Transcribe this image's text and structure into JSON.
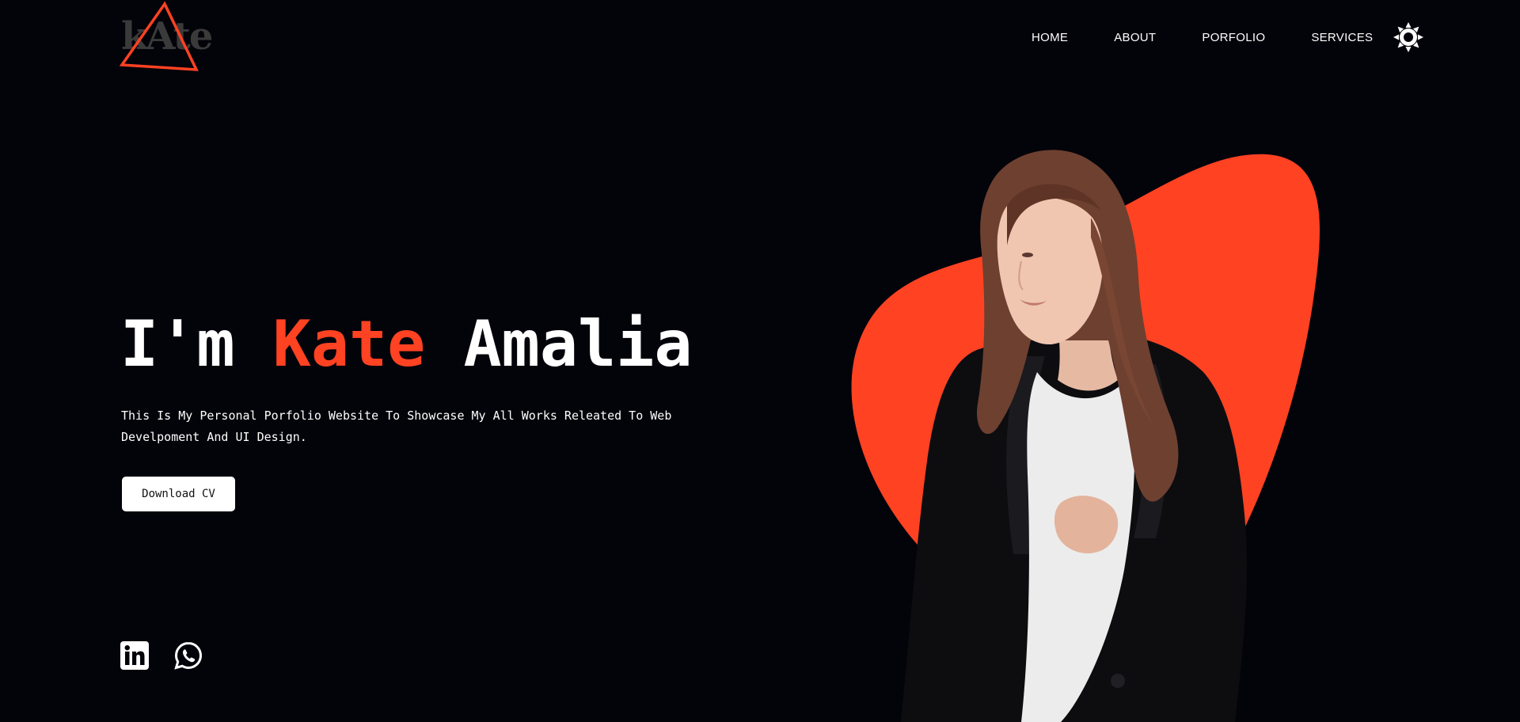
{
  "brand": {
    "logo_text": "kAte",
    "accent_color": "#ff4222",
    "background_color": "#03030a"
  },
  "nav": {
    "items": [
      {
        "label": "HOME"
      },
      {
        "label": "ABOUT"
      },
      {
        "label": "PORFOLIO"
      },
      {
        "label": "SERVICES"
      }
    ],
    "theme_toggle_icon": "sun-icon"
  },
  "hero": {
    "title_prefix": "I'm",
    "title_first_name": "Kate",
    "title_last_name": "Amalia",
    "description": "This Is My Personal Porfolio Website To Showcase My All Works Releated To Web Develpoment And UI Design.",
    "cta_label": "Download CV"
  },
  "social": {
    "icons": [
      "linkedin-icon",
      "whatsapp-icon"
    ]
  }
}
